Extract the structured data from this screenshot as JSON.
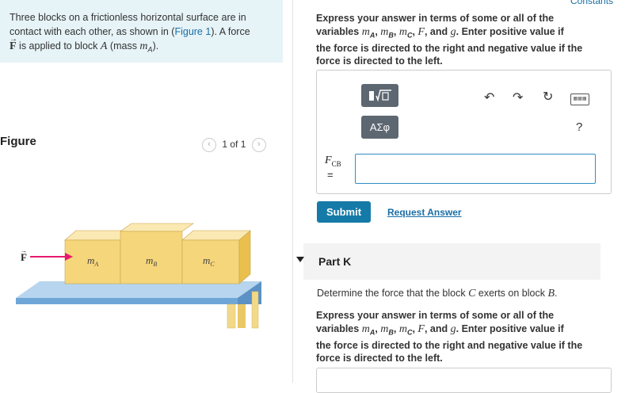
{
  "problem": {
    "line1": "Three blocks on a frictionless horizontal surface are in",
    "line2_prefix": "contact with each other, as shown in (",
    "figure_link": "Figure 1",
    "line2_suffix": "). A force",
    "force_symbol": "F",
    "line3_mid": " is applied to block ",
    "block_a": "A",
    "mass_prefix": " (mass ",
    "mass_symbol": "m",
    "mass_sub": "A",
    "mass_suffix": ")."
  },
  "figure": {
    "label": "Figure",
    "pager_text": "1 of 1",
    "prev_icon": "chevron-left-icon",
    "next_icon": "chevron-right-icon",
    "force_label": "F",
    "blocks": [
      {
        "sym": "m",
        "sub": "A"
      },
      {
        "sym": "m",
        "sub": "B"
      },
      {
        "sym": "m",
        "sub": "C"
      }
    ],
    "colors": {
      "arrow": "#e8196e",
      "block_top": "#fbe9b3",
      "block_front": "#f6d67a",
      "block_side": "#e9bf4e",
      "table_top": "#b7d5ee",
      "table_front": "#6fa6d8",
      "leg": "#f2d98a"
    }
  },
  "header": {
    "constants_link": "Constants"
  },
  "part_j": {
    "instr_a": "Express your answer in terms of some or all of the",
    "instr_b": "variables ",
    "vars": [
      "m",
      "A",
      "m",
      "B",
      "m",
      "C",
      "F",
      "g"
    ],
    "instr_c": ". Enter positive value if",
    "instr_d": "the force is directed to the right and negative value if the",
    "instr_e": "force is directed to the left.",
    "toolbar": {
      "templates_button": "templates",
      "greek_button": "ΑΣφ",
      "undo_icon": "undo-icon",
      "redo_icon": "redo-icon",
      "reset_icon": "reset-icon",
      "keyboard_icon": "keyboard-icon",
      "help_label": "?"
    },
    "answer_label": "F",
    "answer_sub": "CB",
    "equals": "=",
    "input_value": "",
    "submit_label": "Submit",
    "request_label": "Request Answer"
  },
  "part_k": {
    "label": "Part K",
    "question_a": "Determine the force that the block ",
    "question_c": "C",
    "question_b": " exerts on block ",
    "question_d": "B",
    "question_e": ".",
    "instr_a": "Express your answer in terms of some or all of the",
    "instr_b": "variables ",
    "instr_c": ". Enter positive value if",
    "instr_d": "the force is directed to the right and negative value if the",
    "instr_e": "force is directed to the left."
  }
}
